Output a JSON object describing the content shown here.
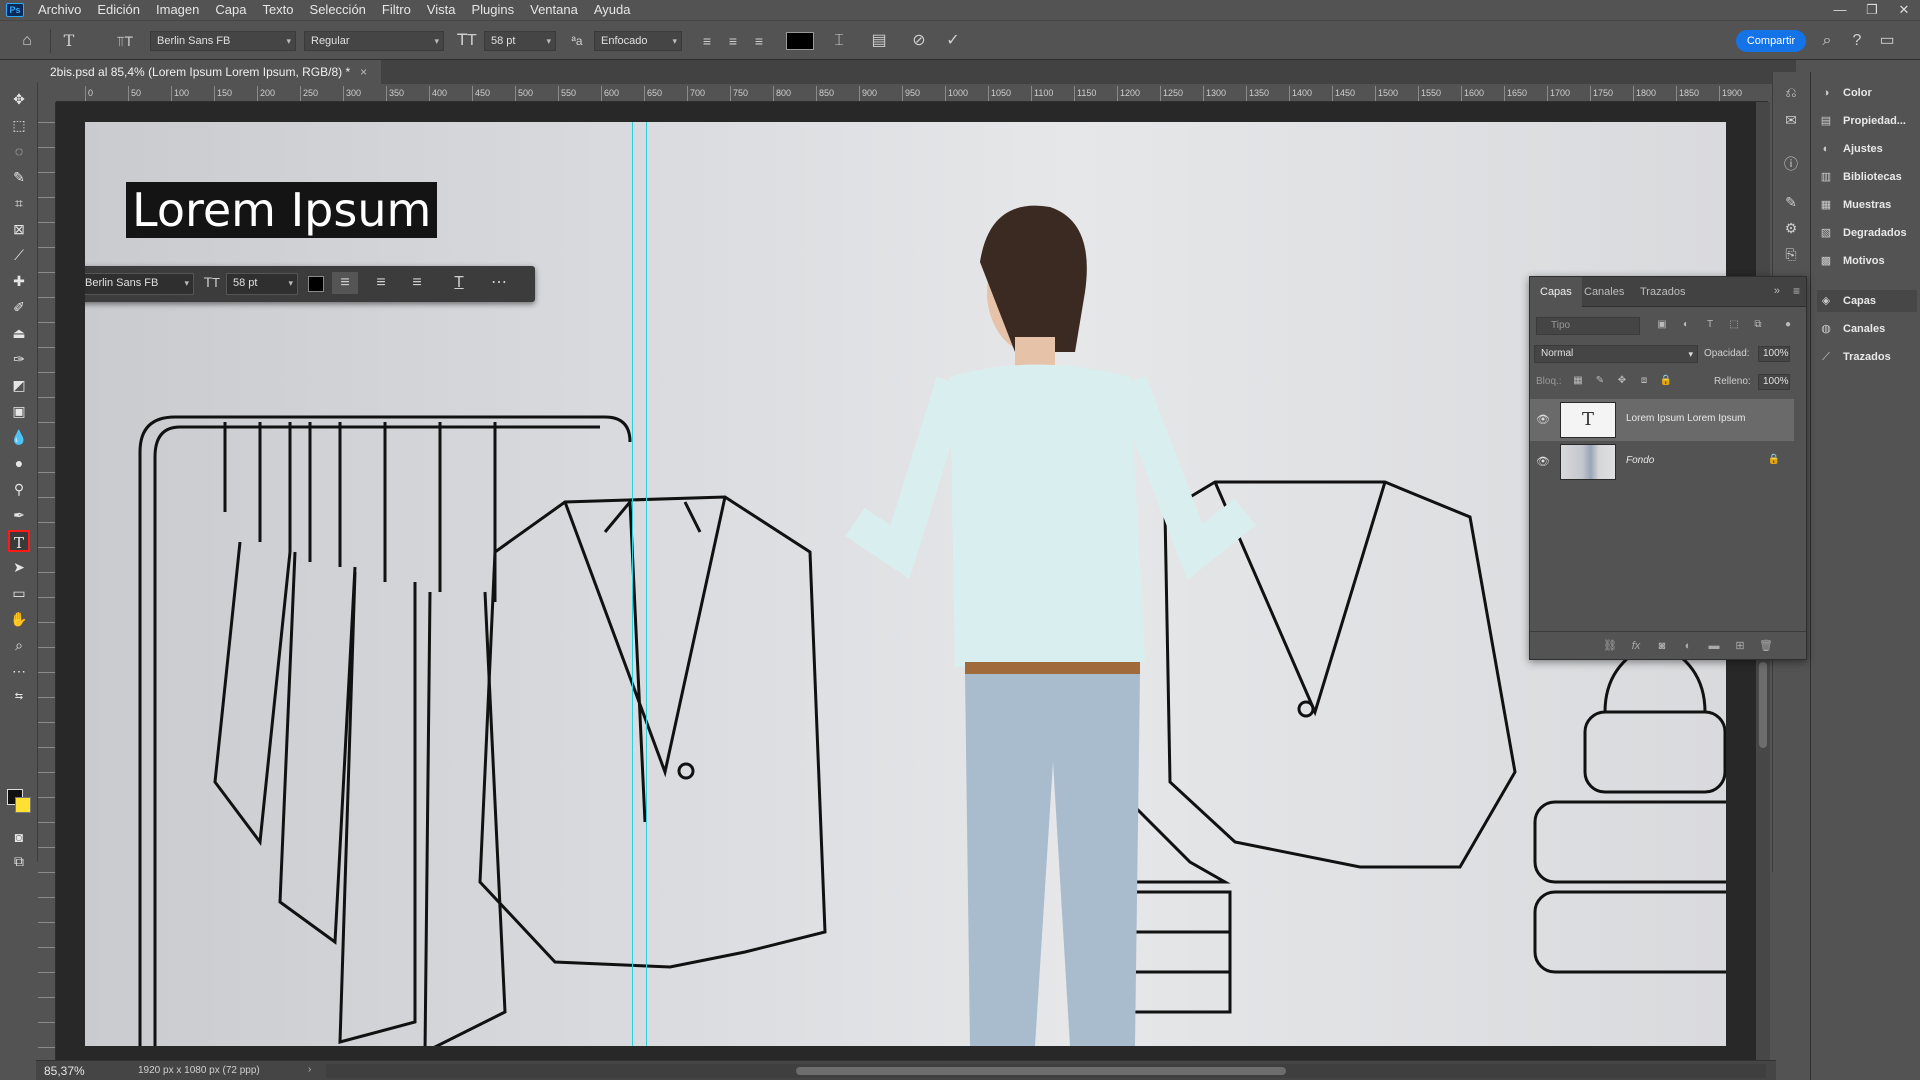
{
  "menubar": {
    "logo": "Ps",
    "items": [
      "Archivo",
      "Edición",
      "Imagen",
      "Capa",
      "Texto",
      "Selección",
      "Filtro",
      "Vista",
      "Plugins",
      "Ventana",
      "Ayuda"
    ],
    "window_controls": [
      "—",
      "❐",
      "✕"
    ]
  },
  "options_bar": {
    "font_family": "Berlin Sans FB",
    "font_style": "Regular",
    "font_size": "58 pt",
    "antialias": "Enfocado",
    "text_color": "#000000",
    "share_label": "Compartir"
  },
  "document": {
    "tab_title": "2bis.psd al 85,4% (Lorem Ipsum Lorem Ipsum, RGB/8) *",
    "headline": "Lorem Ipsum"
  },
  "context_bar": {
    "font_family": "Berlin Sans FB",
    "font_size": "58 pt"
  },
  "ruler": {
    "top_ticks": [
      "0",
      "50",
      "100",
      "150",
      "200",
      "250",
      "300",
      "350",
      "400",
      "450",
      "500",
      "550",
      "600",
      "650",
      "700",
      "750",
      "800",
      "850",
      "900",
      "950",
      "1000",
      "1050",
      "1100",
      "1150",
      "1200",
      "1250",
      "1300",
      "1350",
      "1400",
      "1450",
      "1500",
      "1550",
      "1600",
      "1650",
      "1700",
      "1750",
      "1800",
      "1850",
      "1900"
    ]
  },
  "dock_panels": [
    {
      "label": "Color",
      "icon": "color-wheel-icon"
    },
    {
      "label": "Propiedad...",
      "icon": "properties-icon"
    },
    {
      "label": "Ajustes",
      "icon": "adjustments-icon"
    },
    {
      "label": "Bibliotecas",
      "icon": "libraries-icon"
    },
    {
      "label": "Muestras",
      "icon": "swatches-grid-icon"
    },
    {
      "label": "Degradados",
      "icon": "gradients-icon"
    },
    {
      "label": "Motivos",
      "icon": "patterns-icon"
    },
    {
      "label": "Capas",
      "icon": "layers-icon"
    },
    {
      "label": "Canales",
      "icon": "channels-icon"
    },
    {
      "label": "Trazados",
      "icon": "paths-icon"
    }
  ],
  "layers_panel": {
    "tabs": [
      "Capas",
      "Canales",
      "Trazados"
    ],
    "filter_placeholder": "Tipo",
    "blend_mode": "Normal",
    "opacity_label": "Opacidad:",
    "opacity_value": "100%",
    "lock_label": "Bloq.:",
    "fill_label": "Relleno:",
    "fill_value": "100%",
    "layers": [
      {
        "name": "Lorem Ipsum Lorem Ipsum",
        "thumb": "T",
        "selected": true
      },
      {
        "name": "Fondo",
        "locked": true
      }
    ]
  },
  "status": {
    "zoom": "85,37%",
    "doc_size": "1920 px x 1080 px (72 ppp)"
  },
  "colors": {
    "foreground": "#111111",
    "background": "#ffe033",
    "share": "#1473e6",
    "guide": "#29d0dd",
    "tool_highlight": "#ff1a1a"
  }
}
